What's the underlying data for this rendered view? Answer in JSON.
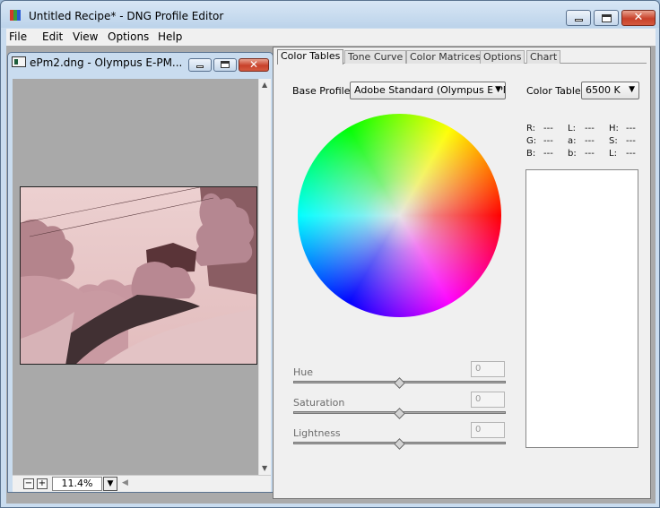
{
  "window": {
    "title": "Untitled Recipe* - DNG Profile Editor",
    "close_glyph": "✕"
  },
  "menu": [
    "File",
    "Edit",
    "View",
    "Options",
    "Help"
  ],
  "document": {
    "title": "ePm2.dng  - Olympus E-PM...",
    "close_glyph": "✕",
    "zoom_minus": "−",
    "zoom_plus": "+",
    "zoom_value": "11.4%",
    "zoom_drop": "▼"
  },
  "tabs": [
    {
      "label": "Color Tables",
      "active": true
    },
    {
      "label": "Tone Curve",
      "active": false
    },
    {
      "label": "Color Matrices",
      "active": false
    },
    {
      "label": "Options",
      "active": false
    },
    {
      "label": "Chart",
      "active": false
    }
  ],
  "base_profile": {
    "label": "Base Profile:",
    "value": "Adobe Standard (Olympus E-PM"
  },
  "color_table": {
    "label": "Color Table:",
    "value": "6500 K"
  },
  "readouts": [
    [
      "R:",
      "---",
      "L:",
      "---",
      "H:",
      "---"
    ],
    [
      "G:",
      "---",
      "a:",
      "---",
      "S:",
      "---"
    ],
    [
      "B:",
      "---",
      "b:",
      "---",
      "L:",
      "---"
    ]
  ],
  "sliders": {
    "hue": {
      "label": "Hue",
      "value": "0"
    },
    "saturation": {
      "label": "Saturation",
      "value": "0"
    },
    "lightness": {
      "label": "Lightness",
      "value": "0"
    }
  },
  "colors": {
    "frame": "#c9dcef",
    "panel": "#f0f0f0",
    "photo_tint": "#d9b1b3"
  },
  "icons": {
    "app": "dng-profile-editor-icon",
    "document": "image-document-icon"
  }
}
